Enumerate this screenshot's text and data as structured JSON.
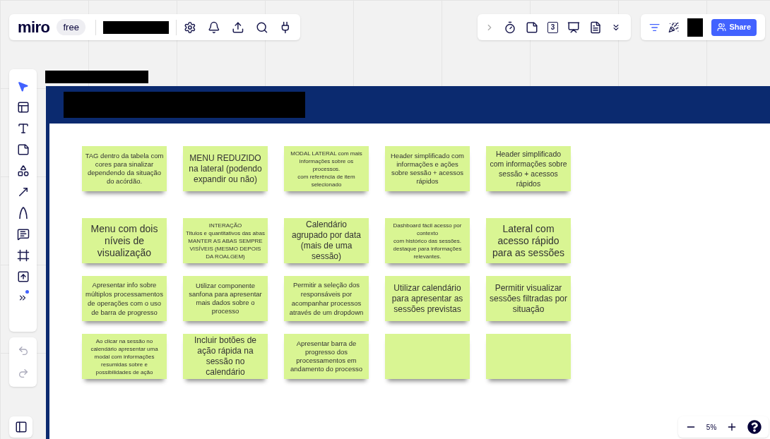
{
  "app_bar": {
    "logo": "miro",
    "plan_badge": "free"
  },
  "center_toolbar": {
    "countdown_glyph": "3"
  },
  "share_button": "Share",
  "zoom_control": {
    "reading": "5%"
  },
  "stickies": [
    {
      "kind": "text",
      "text": "TAG dentro da tabela com cores para sinalizar dependendo da situação do acórdão."
    },
    {
      "kind": "text",
      "text": "MENU REDUZIDO na lateral (podendo expandir ou não)"
    },
    {
      "kind": "text",
      "text": "MODAL LATERAL com mais informações sobre os processos.\ncom referência de item selecionado"
    },
    {
      "kind": "text",
      "text": "Header simplificado com informações e ações sobre sessão + acessos rápidos"
    },
    {
      "kind": "text",
      "text": "Header simplificado com informações sobre sessão + acessos rápidos"
    },
    {
      "kind": "text",
      "text": "Menu com dois níveis de visualização"
    },
    {
      "kind": "text",
      "text": "INTERAÇÃO\nTitulos e quantitativos das abas\nMANTER AS ABAS SEMPRE VISÍVEIS (MESMO DEPOIS DA ROALGEM)"
    },
    {
      "kind": "text",
      "text": "Calendário agrupado por data (mais de uma sessão)"
    },
    {
      "kind": "text",
      "text": "Dashboard fácil acesso por contexto\ncom histórico das sessões.\ndestaque para informações relevantes."
    },
    {
      "kind": "text",
      "text": "Lateral com acesso rápido para as sessões"
    },
    {
      "kind": "text",
      "text": "Apresentar info sobre múltiplos processamentos de operações com o uso de barra de progresso"
    },
    {
      "kind": "text",
      "text": "Utilizar componente sanfona para apresentar mais dados sobre o processo"
    },
    {
      "kind": "text",
      "text": "Permitir a seleção dos responsáveis por acompanhar processos através de um dropdown"
    },
    {
      "kind": "text",
      "text": "Utilizar calendário para apresentar as sessões previstas"
    },
    {
      "kind": "text",
      "text": "Permitir visualizar sessões filtradas por situação"
    },
    {
      "kind": "text",
      "text": "Ao clicar na sessão no calendário apresentar uma modal com informações resumidas sobre e possibilidades de ação"
    },
    {
      "kind": "text",
      "text": "Incluir botões de ação rápida na sessão no calendário"
    },
    {
      "kind": "text",
      "text": "Apresentar barra de progresso dos processamentos em andamento do processo"
    },
    {
      "kind": "blank"
    },
    {
      "kind": "blank"
    }
  ]
}
